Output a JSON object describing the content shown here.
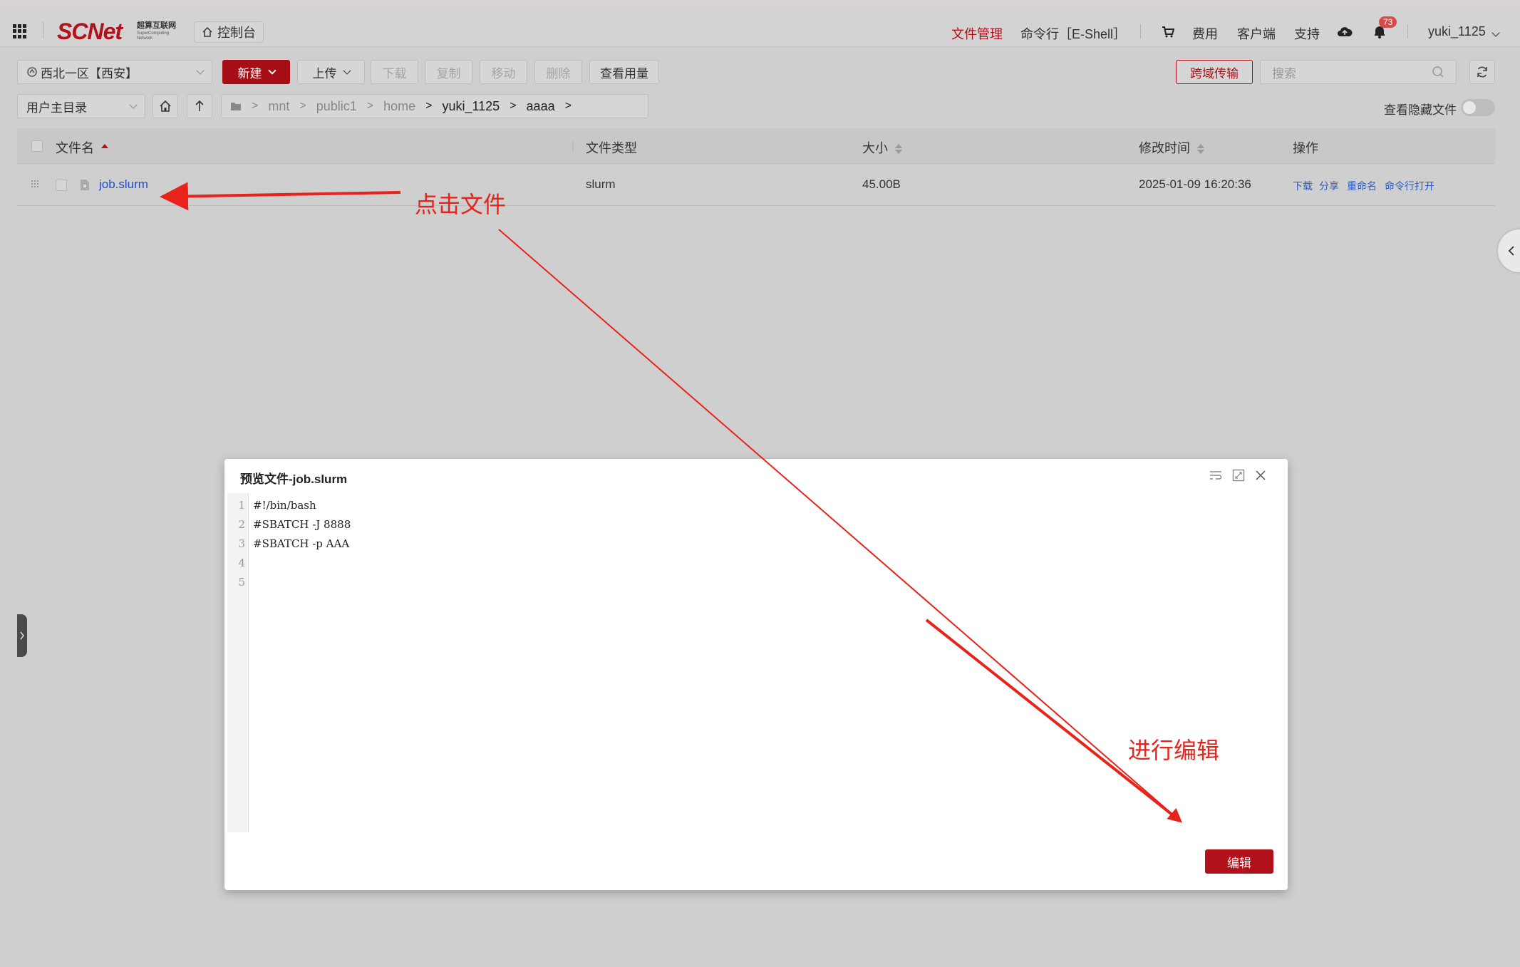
{
  "header": {
    "logo_text": "SCNet",
    "logo_cn": "超算互联网",
    "logo_en": "SuperComputing Network",
    "console_label": "控制台",
    "nav": {
      "file_manager": "文件管理",
      "eshell": "命令行［E-Shell］",
      "fees": "费用",
      "client": "客户端",
      "support": "支持"
    },
    "notification_count": "73",
    "username": "yuki_1125"
  },
  "toolbar": {
    "region": "西北一区【西安】",
    "new_label": "新建",
    "upload_label": "上传",
    "download_label": "下载",
    "copy_label": "复制",
    "move_label": "移动",
    "delete_label": "删除",
    "usage_label": "查看用量",
    "cross_transfer_label": "跨域传输",
    "search_placeholder": "搜索"
  },
  "pathbar": {
    "root_select": "用户主目录",
    "crumbs": [
      "mnt",
      "public1",
      "home",
      "yuki_1125",
      "aaaa"
    ],
    "show_hidden_label": "查看隐藏文件"
  },
  "table": {
    "headers": {
      "name": "文件名",
      "type": "文件类型",
      "size": "大小",
      "mtime": "修改时间",
      "ops": "操作"
    },
    "rows": [
      {
        "name": "job.slurm",
        "type": "slurm",
        "size": "45.00B",
        "mtime": "2025-01-09 16:20:36",
        "ops": [
          "下载",
          "分享",
          "重命名",
          "命令行打开"
        ]
      }
    ]
  },
  "modal": {
    "title": "预览文件-job.slurm",
    "lines": [
      "#!/bin/bash",
      "#SBATCH -J 8888",
      "#SBATCH -p AAA",
      "",
      ""
    ],
    "line_numbers": [
      "1",
      "2",
      "3",
      "4",
      "5"
    ],
    "edit_label": "编辑"
  },
  "annotations": {
    "click_file": "点击文件",
    "edit_hint": "进行编辑",
    "color": "#e8231b"
  },
  "colors": {
    "brand": "#b0111b",
    "link": "#1f4fb8"
  }
}
